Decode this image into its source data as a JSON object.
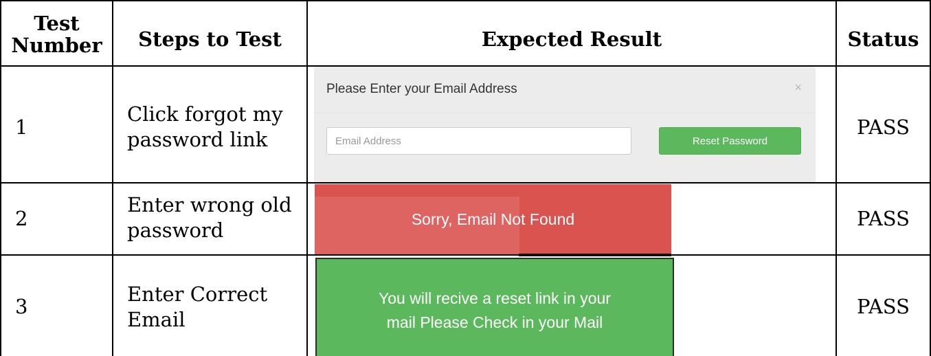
{
  "headers": {
    "test_number": "Test Number",
    "test_number_line1": "Test",
    "test_number_line2": "Number",
    "steps": "Steps to Test",
    "expected": "Expected Result",
    "status": "Status"
  },
  "rows": [
    {
      "number": "1",
      "steps_line1": "Click forgot my",
      "steps_line2": "password link",
      "status": "PASS",
      "expected": {
        "modal_title": "Please Enter your Email Address",
        "close_glyph": "×",
        "email_placeholder": "Email Address",
        "button_label": "Reset Password"
      }
    },
    {
      "number": "2",
      "steps_line1": "Enter wrong old",
      "steps_line2": "password",
      "status": "PASS",
      "expected": {
        "alert_text": "Sorry, Email Not Found"
      }
    },
    {
      "number": "3",
      "steps_line1": "Enter Correct",
      "steps_line2": "Email",
      "status": "PASS",
      "expected": {
        "alert_line1": "You will recive a reset link in your",
        "alert_line2": "mail Please Check in your Mail"
      }
    }
  ],
  "colors": {
    "success": "#5cb85c",
    "danger": "#d9534f",
    "modal_bg": "#ececec"
  }
}
